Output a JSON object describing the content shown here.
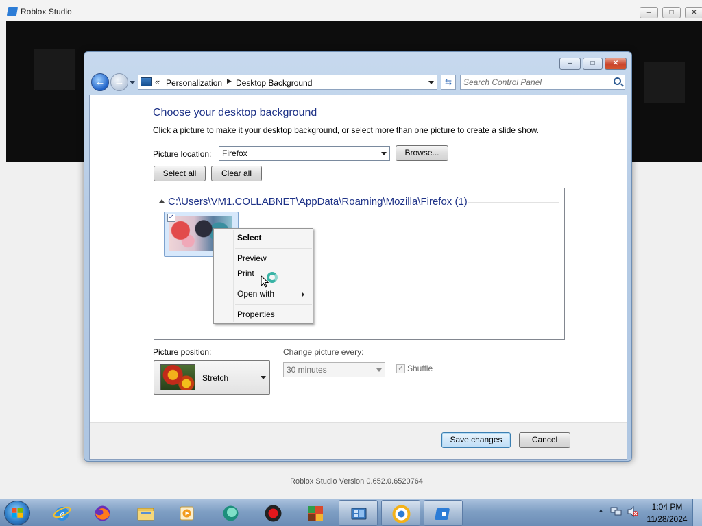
{
  "app": {
    "title": "Roblox Studio",
    "version": "Roblox Studio Version 0.652.0.6520764"
  },
  "control_panel": {
    "breadcrumb": [
      "Personalization",
      "Desktop Background"
    ],
    "search_placeholder": "Search Control Panel",
    "page_title": "Choose your desktop background",
    "page_description": "Click a picture to make it your desktop background, or select more than one picture to create a slide show.",
    "picture_location_label": "Picture location:",
    "picture_location_value": "Firefox",
    "browse_label": "Browse...",
    "select_all_label": "Select all",
    "clear_all_label": "Clear all",
    "folder_header": "C:\\Users\\VM1.COLLABNET\\AppData\\Roaming\\Mozilla\\Firefox (1)",
    "picture_position_label": "Picture position:",
    "picture_position_value": "Stretch",
    "change_every_label": "Change picture every:",
    "change_every_value": "30 minutes",
    "shuffle_label": "Shuffle",
    "save_label": "Save changes",
    "cancel_label": "Cancel"
  },
  "context_menu": {
    "items": [
      "Select",
      "Preview",
      "Print",
      "Open with",
      "Properties"
    ]
  },
  "taskbar": {
    "time": "1:04 PM",
    "date": "11/28/2024"
  },
  "colors": {
    "title_blue": "#1e3287",
    "taskbar": "#7f9fc4",
    "close_red": "#c9452c"
  }
}
